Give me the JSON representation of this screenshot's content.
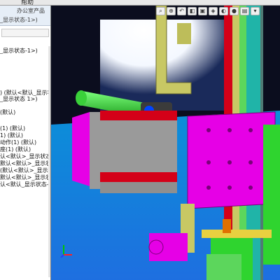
{
  "window": {
    "menu": [
      "帮助"
    ]
  },
  "panel": {
    "office_tab_label": "办公室产品",
    "header_line": "_显示状态-1>)"
  },
  "feature_tree": {
    "items": [
      "_显示状态-1>)",
      ") (默认<默认_显示状态-",
      "_显示状态 1>)",
      "(默认)",
      "(1) (默认)",
      "1) (默认)",
      "动作(1) (默认)",
      "座(1) (默认)",
      "认<默认>_显示状态 1",
      "默认<默认>_显示状态",
      "(默认<默认>_显示状",
      "默认<默认>_显示状态",
      "认<默认_显示状态-1>)"
    ]
  },
  "view_toolbar": {
    "icons": [
      "zoom-to-fit-icon",
      "zoom-area-icon",
      "previous-view-icon",
      "section-view-icon",
      "view-orientation-icon",
      "display-style-icon",
      "hide-show-icon",
      "edit-appearance-icon",
      "apply-scene-icon",
      "view-settings-icon"
    ],
    "glyphs": [
      "⌕",
      "⊕",
      "↶",
      "◧",
      "▣",
      "◈",
      "◐",
      "●",
      "▤",
      "▾"
    ]
  },
  "colors": {
    "magenta": "#e600e6",
    "red": "#d40018",
    "green": "#2fd42f",
    "lime": "#5cd65c",
    "yellow_green": "#c8c864",
    "orange": "#e07000",
    "teal": "#20b4a8",
    "cyan": "#00c8d8",
    "blue_floor": "#1e8aff",
    "white_glow": "#ffffff",
    "dark_bg": "#0b0d1e"
  }
}
